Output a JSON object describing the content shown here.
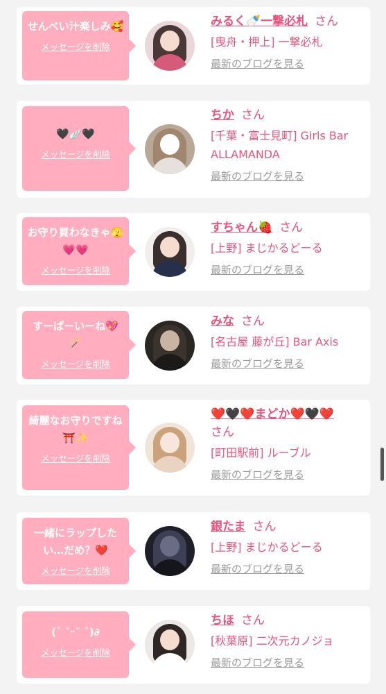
{
  "delete_label": "メッセージを削除",
  "blog_label": "最新のブログを見る",
  "honorific": "さん",
  "colors": {
    "bubble": "#ffadbf",
    "accent": "#e8557c",
    "link_gray": "#9a9a9a"
  },
  "items": [
    {
      "message": "せんべい汁楽しみ🥰",
      "name": "みるく🍼一撃必札",
      "shop": "[曳舟・押上] 一撃必札",
      "avatar": "avatar-photo-milk"
    },
    {
      "message": "🖤🪽🖤",
      "name": "ちか",
      "shop": "[千葉・富士見町] Girls Bar ALLAMANDA",
      "avatar": "avatar-photo-chika"
    },
    {
      "message": "お守り買わなきゃ🫣💗💗",
      "name": "すちゃん🍓",
      "shop": "[上野] まじかるどーる",
      "avatar": "avatar-photo-suchan"
    },
    {
      "message": "すーぱーいーね💖🪄",
      "name": "みな",
      "shop": "[名古屋 藤が丘] Bar Axis",
      "avatar": "avatar-photo-mina"
    },
    {
      "message": "綺麗なお守りですね⛩️✨",
      "name": "❤️🖤❤️まどか❤️🖤❤️",
      "shop": "[町田駅前] ルーブル",
      "avatar": "avatar-photo-madoka"
    },
    {
      "message": "一緒にラップしたい…だめ？❤️",
      "name": "銀たま",
      "shop": "[上野] まじかるどーる",
      "avatar": "avatar-photo-gintama"
    },
    {
      "message": "(ˆ ˘ᵕ˘ ˆ)∂",
      "name": "ちほ",
      "shop": "[秋葉原] 二次元カノジョ",
      "avatar": "avatar-photo-chiho"
    }
  ]
}
